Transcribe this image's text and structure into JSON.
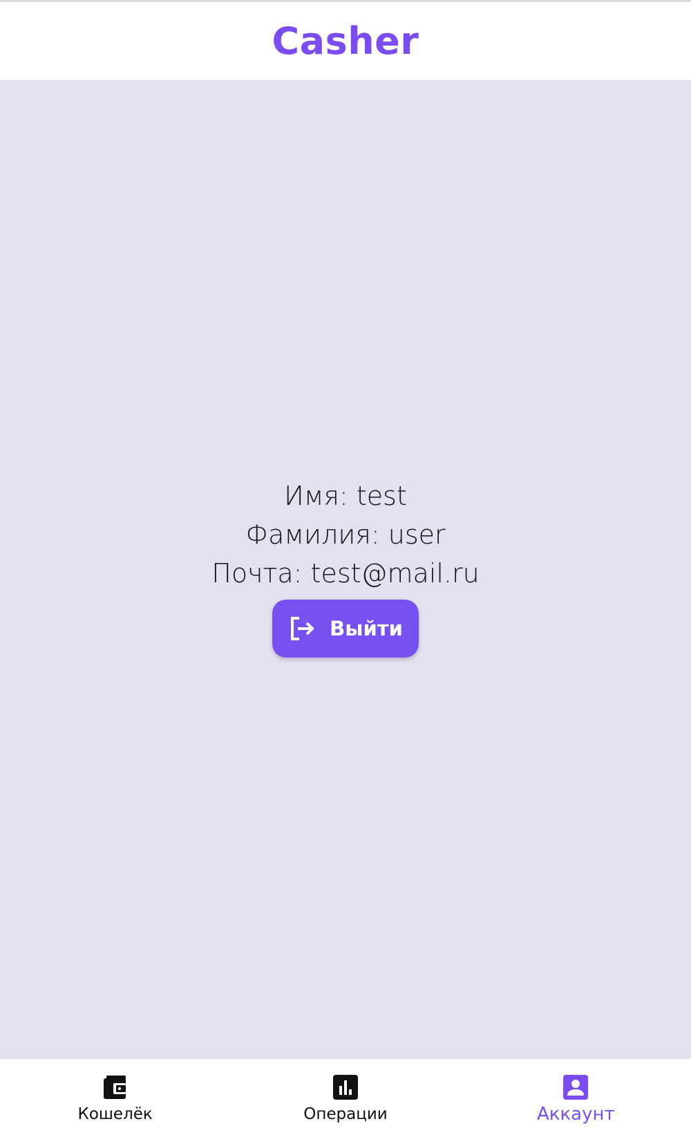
{
  "header": {
    "title": "Casher"
  },
  "profile": {
    "name_line": "Имя: test",
    "surname_line": "Фамилия: user",
    "email_line": "Почта: test@mail.ru",
    "logout_label": "Выйти",
    "logout_icon": "logout-icon"
  },
  "bottom_nav": {
    "items": [
      {
        "label": "Кошелёк",
        "icon": "wallet-icon",
        "active": false
      },
      {
        "label": "Операции",
        "icon": "bar-chart-icon",
        "active": false
      },
      {
        "label": "Аккаунт",
        "icon": "account-icon",
        "active": true
      }
    ]
  },
  "colors": {
    "accent": "#7a4cf2",
    "content_background": "#e3e0ef",
    "header_background": "#ffffff",
    "text": "#151515",
    "icon_inactive": "#111111"
  }
}
